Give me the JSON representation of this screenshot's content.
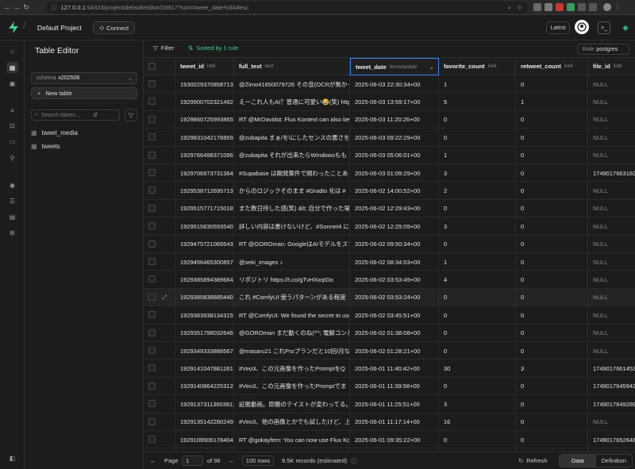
{
  "browser": {
    "url_host": "127.0.0.1",
    "url_rest": ":54323/project/default/editor/33917?sort=tweet_date%3Adesc"
  },
  "header": {
    "project_name": "Default Project",
    "connect_label": "Connect",
    "latest_label": "Latest"
  },
  "sidebar": {
    "title": "Table Editor",
    "schema_label": "schema",
    "schema_value": "x202506",
    "new_table_label": "New table",
    "search_placeholder": "Search tables...",
    "tables": [
      "tweet_media",
      "tweets"
    ]
  },
  "toolbar": {
    "filter_label": "Filter",
    "sort_label": "Sorted by 1 rule",
    "role_label": "Role",
    "role_value": "postgres"
  },
  "grid": {
    "columns": [
      {
        "name": "tweet_id",
        "type": "int8"
      },
      {
        "name": "full_text",
        "type": "text"
      },
      {
        "name": "tweet_date",
        "type": "timestamptz"
      },
      {
        "name": "favorite_count",
        "type": "int4"
      },
      {
        "name": "retweet_count",
        "type": "int4"
      },
      {
        "name": "file_id",
        "type": "int8"
      }
    ],
    "rows": [
      [
        "19300293708587130",
        "@Zimo41650079726 その音(OCRが無かった",
        "2025-06-03 22:30:34+00",
        "1",
        "0",
        "NULL"
      ],
      [
        "19299007023214920",
        "えーこれ人もAI？普通に可愛い😂(笑) https",
        "2025-06-03 13:59:17+00",
        "5",
        "1",
        "NULL"
      ],
      [
        "19298607259938650",
        "RT @MrDavidst: Flux Kontext can also be",
        "2025-06-03 11:20:26+00",
        "0",
        "0",
        "NULL"
      ],
      [
        "19298310421788590",
        "@zubapita まぁ/を\\にしたセンスの悪さを",
        "2025-06-03 09:22:29+00",
        "0",
        "0",
        "NULL"
      ],
      [
        "19297664983710960",
        "@zubapita それが出来たらWindowsもも",
        "2025-06-03 05:06:01+00",
        "1",
        "0",
        "NULL"
      ],
      [
        "19297069737313648",
        "#Supabase は開発案件で関わったことあ",
        "2025-06-03 01:09:29+00",
        "3",
        "0",
        "17490176631836"
      ],
      [
        "19295387126957138",
        "からのロジックそのまま #Gradio 化は #",
        "2025-06-02 14:00:52+00",
        "2",
        "0",
        "NULL"
      ],
      [
        "19295157717150189",
        "また数日待した感(笑) &lt; 自分で作った場",
        "2025-06-02 12:29:43+00",
        "0",
        "0",
        "NULL"
      ],
      [
        "19295156305935400",
        "詳しい内容は書けないけど、#Sonnet4 に",
        "2025-06-02 12:29:09+00",
        "3",
        "0",
        "NULL"
      ],
      [
        "19294757210695430",
        "RT @GOROman: GoogleはAIモデルをスマ",
        "2025-06-02 09:50:34+00",
        "0",
        "0",
        "NULL"
      ],
      [
        "19294564653008570",
        "@seki_images ♪",
        "2025-06-02 08:34:03+00",
        "1",
        "0",
        "NULL"
      ],
      [
        "19293858943896645",
        "リポジトリ https://t.co/gTvHXxqIDo",
        "2025-06-02 03:53:49+00",
        "4",
        "0",
        "NULL"
      ],
      [
        "19293858388854400",
        "これ #ComfyUI 使うパターンがある程度",
        "2025-06-02 03:53:24+00",
        "0",
        "0",
        "NULL"
      ],
      [
        "19293839381343150",
        "RT @ComfyUI: We found the secret to use",
        "2025-06-02 03:45:51+00",
        "0",
        "0",
        "NULL"
      ],
      [
        "19293517980326460",
        "@GOROman まだ動くのね(^^; 電解コンと",
        "2025-06-02 01:38:08+00",
        "0",
        "0",
        "NULL"
      ],
      [
        "19293493338885670",
        "@masaru21 これProプランだと10回/月なん",
        "2025-06-02 01:28:21+00",
        "0",
        "0",
        "NULL"
      ],
      [
        "19291410478812613",
        "#Veo3、この元画像を作ったPromptをQ",
        "2025-06-01 11:40:42+00",
        "30",
        "3",
        "17490176614533"
      ],
      [
        "19291408642253128",
        "#Veo3、この元画像を作ったPromptでま",
        "2025-06-01 11:39:58+00",
        "0",
        "0",
        "17490176459436"
      ],
      [
        "19291373113603812",
        "証拠動画。即勝のテイストが変わってる。",
        "2025-06-01 11:25:51+00",
        "3",
        "0",
        "17490176492894"
      ],
      [
        "19291351422802490",
        "#Veo3、他の画像とかでも試したけど、上",
        "2025-06-01 11:17:14+00",
        "16",
        "0",
        "NULL"
      ],
      [
        "19291095061784040",
        "RT @gokayfem: You can now use Flux Kon",
        "2025-06-01 09:35:22+00",
        "0",
        "0",
        "17490176526484"
      ],
      [
        "19291043010630800",
        "久々に超一驚いたショッキング映像(笑)",
        "2025-06-01 09:14:41+00",
        "3",
        "0",
        "NULL"
      ],
      [
        "19291030590087860",
        "これImagen-4ね。",
        "2025-06-01 09:09:44+00",
        "4",
        "0",
        "NULL"
      ]
    ]
  },
  "footer": {
    "page_label": "Page",
    "page_value": "1",
    "of_label": "of 96",
    "rows_label": "100 rows",
    "records_label": "9.5K records (estimated)",
    "refresh_label": "Refresh",
    "data_label": "Data",
    "definition_label": "Definition"
  }
}
